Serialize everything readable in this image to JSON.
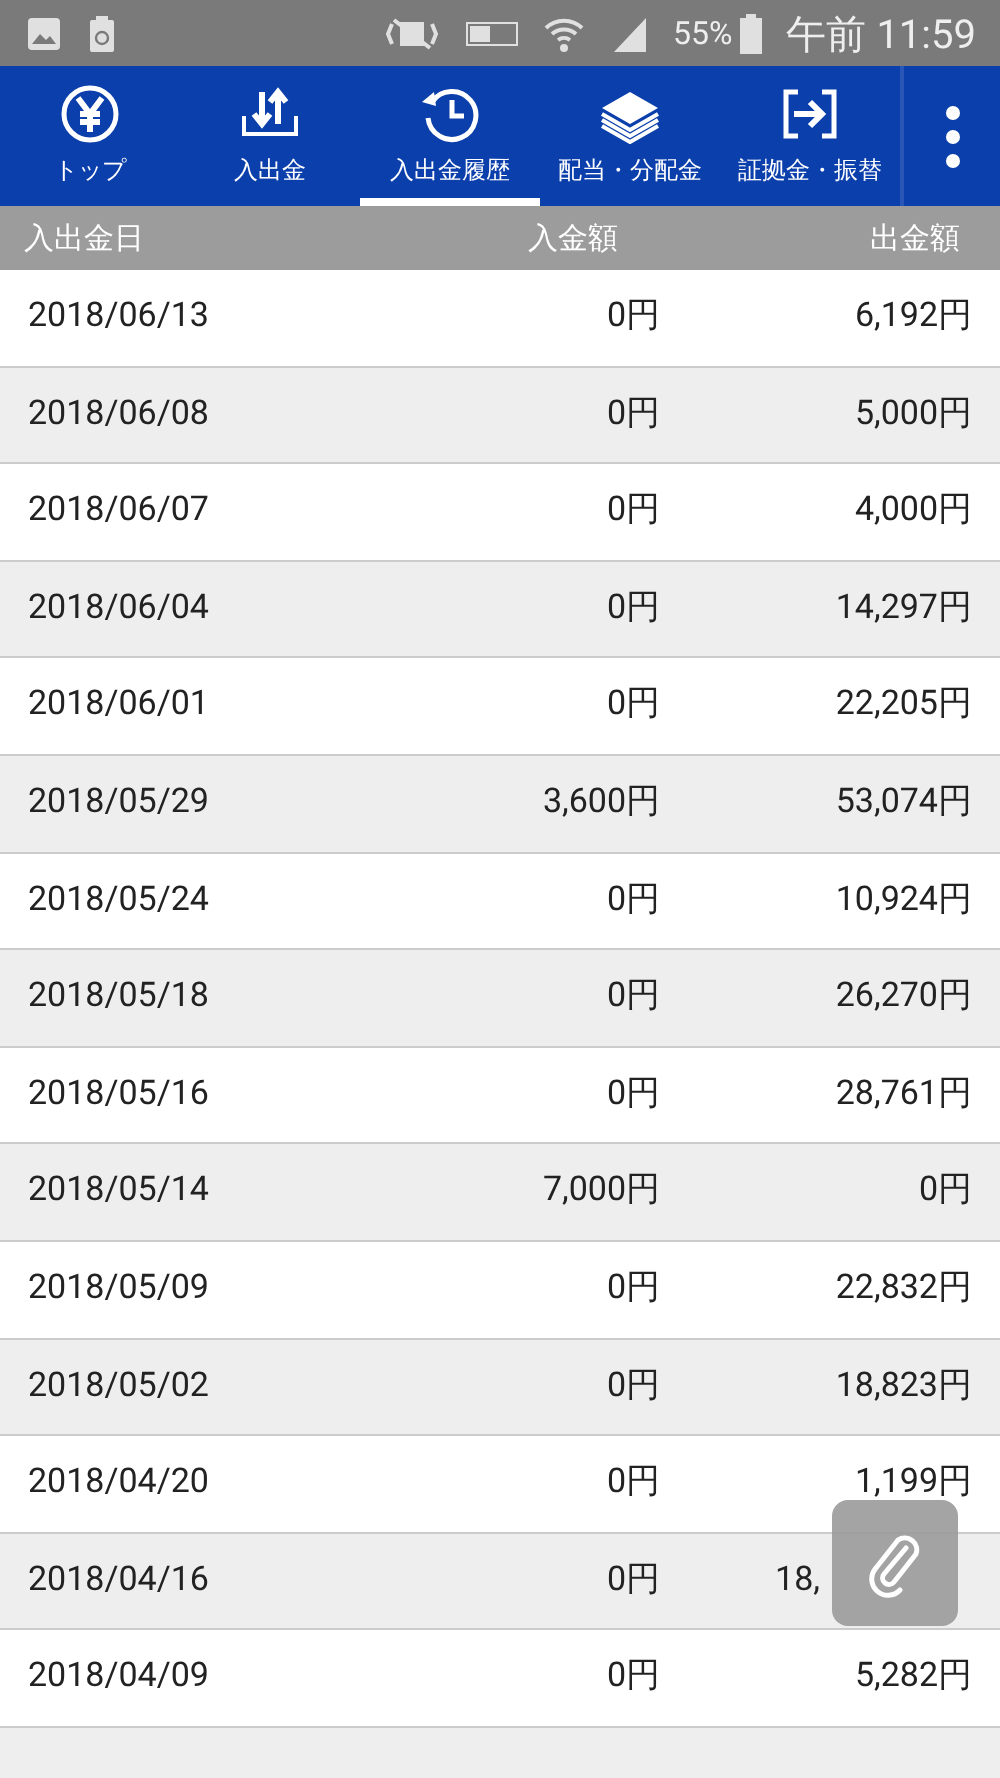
{
  "status_bar": {
    "battery": "55%",
    "time": "午前 11:59"
  },
  "tabs": [
    {
      "label": "トップ",
      "selected": false
    },
    {
      "label": "入出金",
      "selected": false
    },
    {
      "label": "入出金履歴",
      "selected": true
    },
    {
      "label": "配当・分配金",
      "selected": false
    },
    {
      "label": "証拠金・振替",
      "selected": false
    }
  ],
  "table": {
    "columns": [
      "入出金日",
      "入金額",
      "出金額"
    ],
    "rows": [
      {
        "date": "2018/06/13",
        "deposit": "0円",
        "withdrawal": "6,192円"
      },
      {
        "date": "2018/06/08",
        "deposit": "0円",
        "withdrawal": "5,000円"
      },
      {
        "date": "2018/06/07",
        "deposit": "0円",
        "withdrawal": "4,000円"
      },
      {
        "date": "2018/06/04",
        "deposit": "0円",
        "withdrawal": "14,297円"
      },
      {
        "date": "2018/06/01",
        "deposit": "0円",
        "withdrawal": "22,205円"
      },
      {
        "date": "2018/05/29",
        "deposit": "3,600円",
        "withdrawal": "53,074円"
      },
      {
        "date": "2018/05/24",
        "deposit": "0円",
        "withdrawal": "10,924円"
      },
      {
        "date": "2018/05/18",
        "deposit": "0円",
        "withdrawal": "26,270円"
      },
      {
        "date": "2018/05/16",
        "deposit": "0円",
        "withdrawal": "28,761円"
      },
      {
        "date": "2018/05/14",
        "deposit": "7,000円",
        "withdrawal": "0円"
      },
      {
        "date": "2018/05/09",
        "deposit": "0円",
        "withdrawal": "22,832円"
      },
      {
        "date": "2018/05/02",
        "deposit": "0円",
        "withdrawal": "18,823円"
      },
      {
        "date": "2018/04/20",
        "deposit": "0円",
        "withdrawal": "1,199円"
      },
      {
        "date": "2018/04/16",
        "deposit": "0円",
        "withdrawal": "18,",
        "covered": true
      },
      {
        "date": "2018/04/09",
        "deposit": "0円",
        "withdrawal": "5,282円"
      }
    ]
  }
}
